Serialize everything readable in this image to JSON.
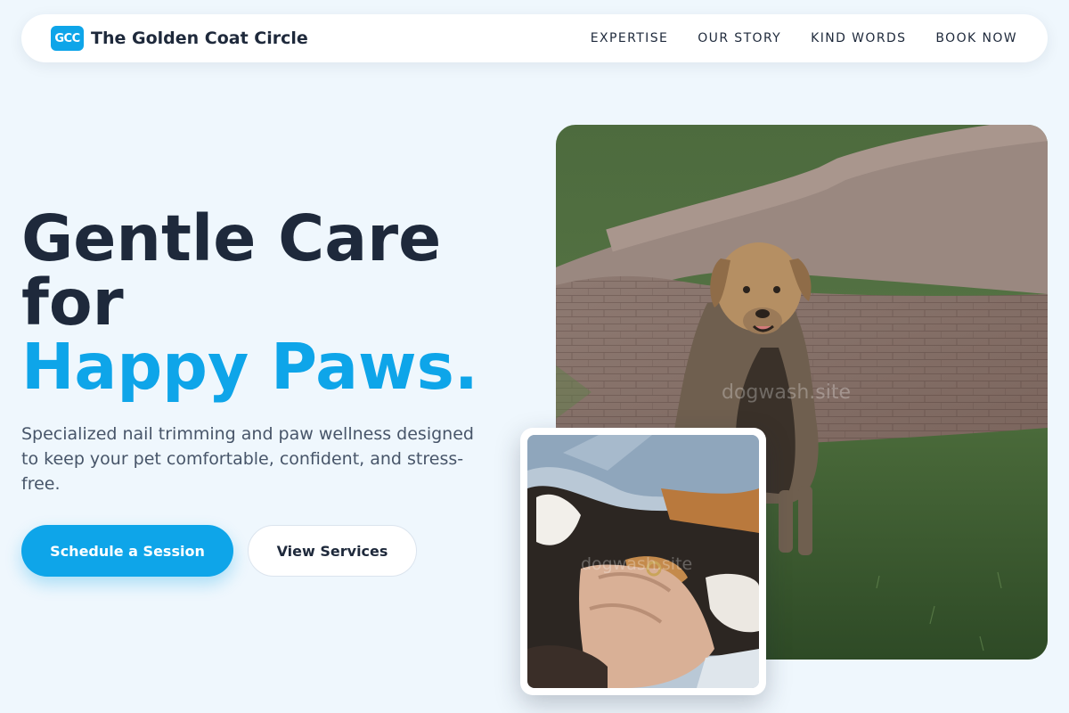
{
  "brand": {
    "logo_text": "GCC",
    "name": "The Golden Coat Circle"
  },
  "nav": {
    "links": [
      {
        "label": "EXPERTISE"
      },
      {
        "label": "OUR STORY"
      },
      {
        "label": "KIND WORDS"
      },
      {
        "label": "BOOK NOW"
      }
    ]
  },
  "hero": {
    "title_line1": "Gentle Care",
    "title_line2": "for",
    "title_accent": "Happy Paws.",
    "subtitle": "Specialized nail trimming and paw wellness designed to keep your pet comfortable, confident, and stress-free.",
    "primary_button": "Schedule a Session",
    "secondary_button": "View Services"
  },
  "images": {
    "main_alt": "Dog sitting on grass near a brick path",
    "inset_alt": "Person holding a calico cat",
    "watermark": "dogwash.site"
  },
  "colors": {
    "accent": "#0ea5e9",
    "heading": "#1e293b",
    "background": "#eff7fd"
  }
}
